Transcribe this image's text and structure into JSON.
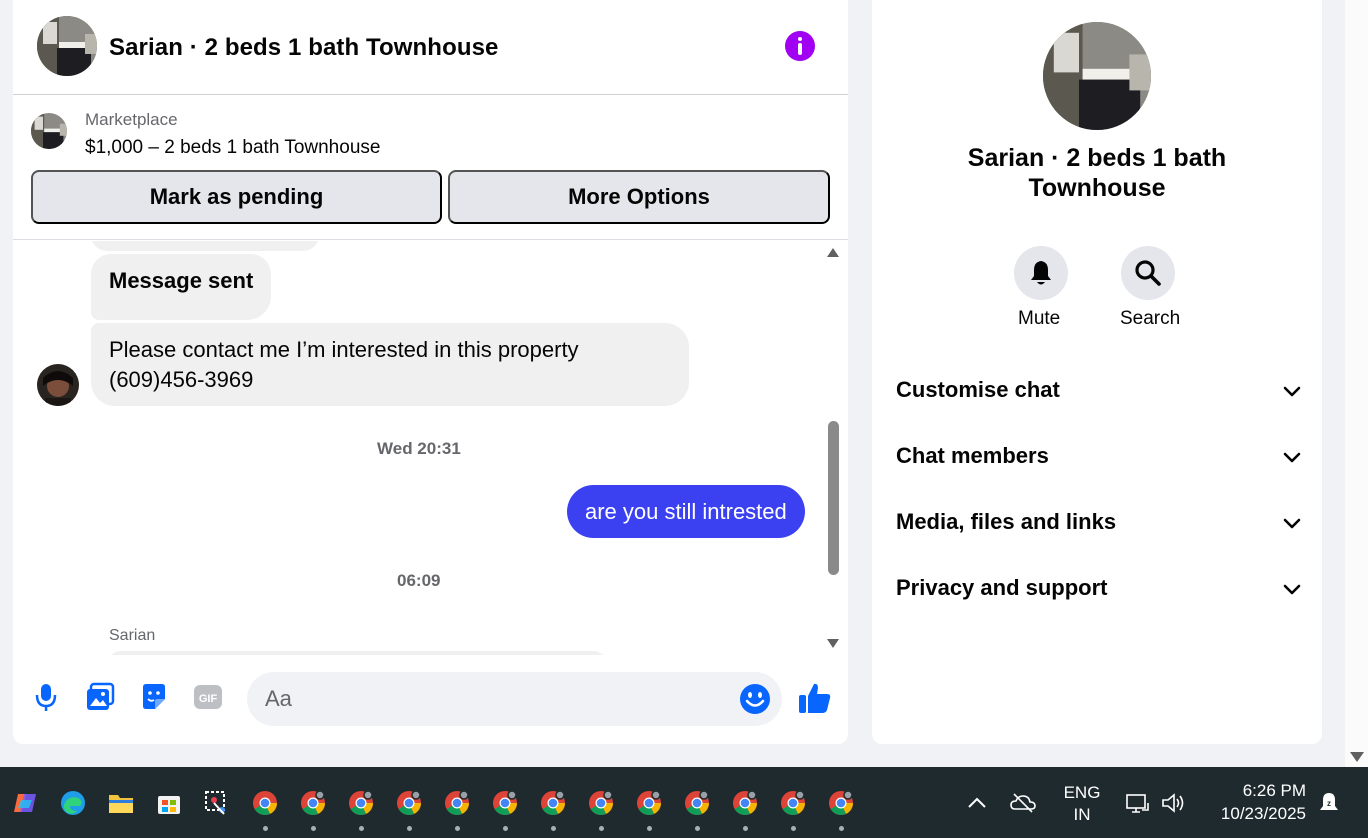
{
  "chat": {
    "title": "Sarian · 2 beds 1 bath Townhouse",
    "listing": {
      "source": "Marketplace",
      "price_line": "$1,000 – 2 beds 1 bath Townhouse",
      "mark_pending_label": "Mark as pending",
      "more_options_label": "More Options"
    },
    "messages": {
      "sent_note": "Message sent",
      "contact_message": "Please contact me I’m interested in this property (609)456-3969",
      "timestamp_1": "Wed 20:31",
      "outgoing_message": "are you still intrested",
      "timestamp_2": "06:09",
      "sender_name": "Sarian"
    },
    "composer": {
      "placeholder": "Aa"
    }
  },
  "info": {
    "title": "Sarian · 2 beds 1 bath Townhouse",
    "mute_label": "Mute",
    "search_label": "Search",
    "sections": [
      {
        "label": "Customise chat"
      },
      {
        "label": "Chat members"
      },
      {
        "label": "Media, files and links"
      },
      {
        "label": "Privacy and support"
      }
    ]
  },
  "taskbar": {
    "language_top": "ENG",
    "language_bottom": "IN",
    "time": "6:26 PM",
    "date": "10/23/2025"
  },
  "colors": {
    "accent": "#3b41f0",
    "info_button": "#a100f2",
    "composer_icons": "#0866ff",
    "bubble_incoming": "#f0f0f0",
    "taskbar": "#1f2a2f"
  },
  "icons": [
    "info-icon",
    "microphone-icon",
    "photo-icon",
    "sticker-icon",
    "gif-icon",
    "emoji-icon",
    "thumbs-up-icon",
    "bell-icon",
    "search-icon",
    "chevron-down-icon"
  ]
}
